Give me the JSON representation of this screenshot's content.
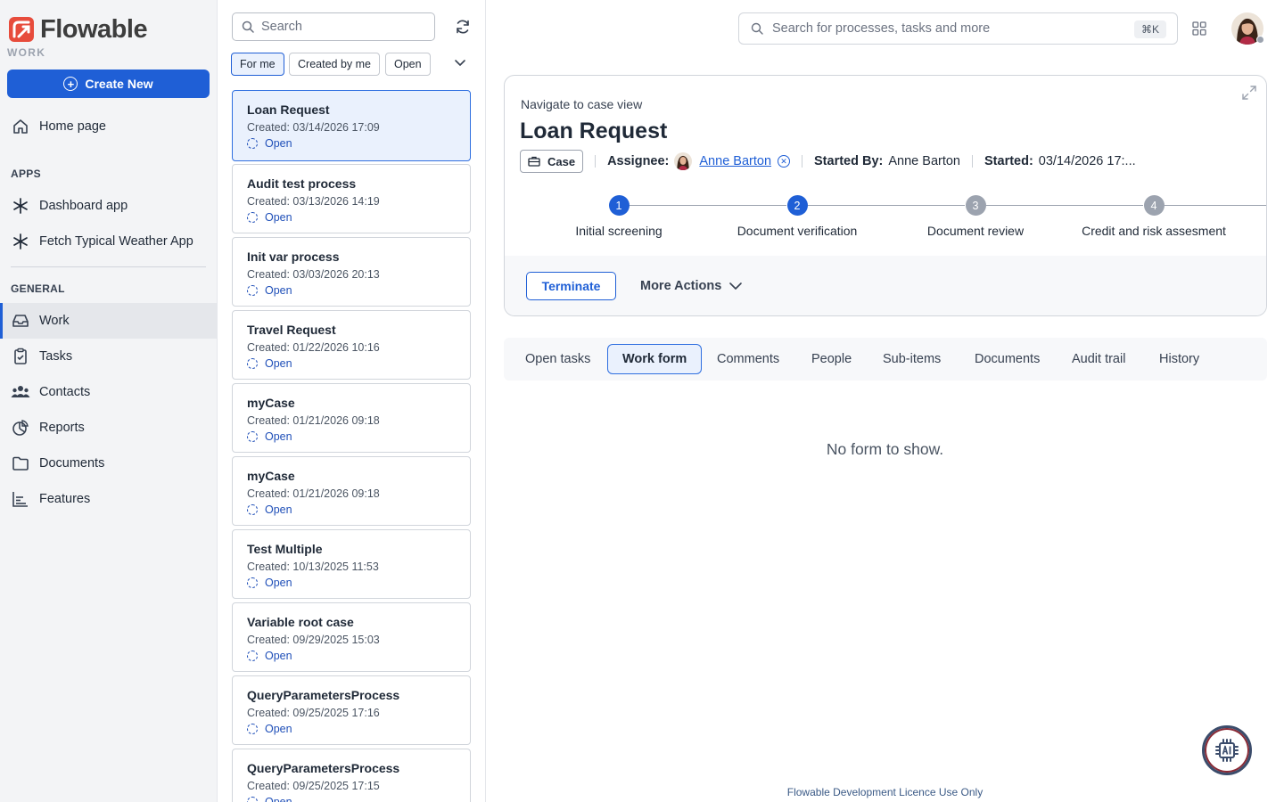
{
  "app": {
    "logo_text": "Flowable",
    "logo_subtitle": "WORK",
    "create_new_label": "Create New",
    "brand_color": "#1f5fd6",
    "logo_color": "#e74c3c"
  },
  "sidebar": {
    "home_label": "Home page",
    "apps_section": "APPS",
    "apps": [
      {
        "label": "Dashboard app",
        "icon": "asterisk-icon"
      },
      {
        "label": "Fetch Typical Weather App",
        "icon": "asterisk-icon"
      }
    ],
    "general_section": "GENERAL",
    "general": [
      {
        "label": "Work",
        "icon": "inbox-icon",
        "active": true
      },
      {
        "label": "Tasks",
        "icon": "clipboard-icon"
      },
      {
        "label": "Contacts",
        "icon": "people-icon"
      },
      {
        "label": "Reports",
        "icon": "pie-chart-icon"
      },
      {
        "label": "Documents",
        "icon": "folder-icon"
      },
      {
        "label": "Features",
        "icon": "bar-chart-icon"
      }
    ]
  },
  "list": {
    "search_placeholder": "Search",
    "filters": [
      "For me",
      "Created by me",
      "Open"
    ],
    "active_filter": "For me",
    "items": [
      {
        "title": "Loan Request",
        "created": "Created: 03/14/2026 17:09",
        "status": "Open"
      },
      {
        "title": "Audit test process",
        "created": "Created: 03/13/2026 14:19",
        "status": "Open"
      },
      {
        "title": "Init var process",
        "created": "Created: 03/03/2026 20:13",
        "status": "Open"
      },
      {
        "title": "Travel Request",
        "created": "Created: 01/22/2026 10:16",
        "status": "Open"
      },
      {
        "title": "myCase",
        "created": "Created: 01/21/2026 09:18",
        "status": "Open"
      },
      {
        "title": "myCase",
        "created": "Created: 01/21/2026 09:18",
        "status": "Open"
      },
      {
        "title": "Test Multiple",
        "created": "Created: 10/13/2025 11:53",
        "status": "Open"
      },
      {
        "title": "Variable root case",
        "created": "Created: 09/29/2025 15:03",
        "status": "Open"
      },
      {
        "title": "QueryParametersProcess",
        "created": "Created: 09/25/2025 17:16",
        "status": "Open"
      },
      {
        "title": "QueryParametersProcess",
        "created": "Created: 09/25/2025 17:15",
        "status": "Open"
      }
    ]
  },
  "header": {
    "search_placeholder": "Search for processes, tasks and more",
    "shortcut": "⌘K"
  },
  "case": {
    "nav_link": "Navigate to case view",
    "title": "Loan Request",
    "type_badge": "Case",
    "assignee_label": "Assignee:",
    "assignee_name": "Anne Barton",
    "started_by_label": "Started By:",
    "started_by": "Anne Barton",
    "started_label": "Started:",
    "started": "03/14/2026 17:...",
    "steps": [
      {
        "number": "1",
        "label": "Initial screening",
        "state": "done"
      },
      {
        "number": "2",
        "label": "Document verification",
        "state": "done"
      },
      {
        "number": "3",
        "label": "Document review",
        "state": "todo"
      },
      {
        "number": "4",
        "label": "Credit and risk assesment",
        "state": "todo"
      }
    ],
    "terminate_label": "Terminate",
    "more_actions_label": "More Actions"
  },
  "tabs": {
    "items": [
      "Open tasks",
      "Work form",
      "Comments",
      "People",
      "Sub-items",
      "Documents",
      "Audit trail",
      "History"
    ],
    "active": "Work form"
  },
  "content": {
    "empty_message": "No form to show."
  },
  "footer": {
    "text": "Flowable Development Licence Use Only"
  }
}
